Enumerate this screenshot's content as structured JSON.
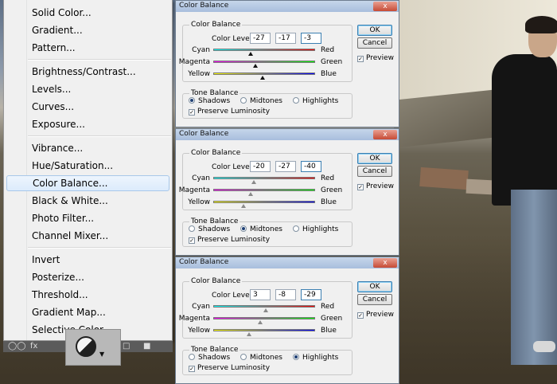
{
  "menu": {
    "items": [
      {
        "label": "Solid Color...",
        "selected": false
      },
      {
        "label": "Gradient...",
        "selected": false
      },
      {
        "label": "Pattern...",
        "selected": false
      },
      {
        "label": "Brightness/Contrast...",
        "selected": false
      },
      {
        "label": "Levels...",
        "selected": false
      },
      {
        "label": "Curves...",
        "selected": false
      },
      {
        "label": "Exposure...",
        "selected": false
      },
      {
        "label": "Vibrance...",
        "selected": false
      },
      {
        "label": "Hue/Saturation...",
        "selected": false
      },
      {
        "label": "Color Balance...",
        "selected": true
      },
      {
        "label": "Black & White...",
        "selected": false
      },
      {
        "label": "Photo Filter...",
        "selected": false
      },
      {
        "label": "Channel Mixer...",
        "selected": false
      },
      {
        "label": "Invert",
        "selected": false
      },
      {
        "label": "Posterize...",
        "selected": false
      },
      {
        "label": "Threshold...",
        "selected": false
      },
      {
        "label": "Gradient Map...",
        "selected": false
      },
      {
        "label": "Selective Color...",
        "selected": false
      }
    ]
  },
  "icons": {
    "adjustment_layer": "half-circle-adjustment-icon",
    "dropdown": "triangle-down-icon",
    "close": "close-icon"
  },
  "dialogs": [
    {
      "title": "Color Balance",
      "close_label": "x",
      "group_label": "Color Balance",
      "levels_label": "Color Levels:",
      "levels": [
        "-27",
        "-17",
        "-3"
      ],
      "sliders": [
        {
          "left": "Cyan",
          "right": "Red",
          "value": -27
        },
        {
          "left": "Magenta",
          "right": "Green",
          "value": -17
        },
        {
          "left": "Yellow",
          "right": "Blue",
          "value": -3
        }
      ],
      "tone_label": "Tone Balance",
      "tones": [
        {
          "label": "Shadows",
          "on": true
        },
        {
          "label": "Midtones",
          "on": false
        },
        {
          "label": "Highlights",
          "on": false
        }
      ],
      "preserve_label": "Preserve Luminosity",
      "ok": "OK",
      "cancel": "Cancel",
      "preview": "Preview"
    },
    {
      "title": "Color Balance",
      "close_label": "x",
      "group_label": "Color Balance",
      "levels_label": "Color Levels:",
      "levels": [
        "-20",
        "-27",
        "-40"
      ],
      "sliders": [
        {
          "left": "Cyan",
          "right": "Red",
          "value": -20
        },
        {
          "left": "Magenta",
          "right": "Green",
          "value": -27
        },
        {
          "left": "Yellow",
          "right": "Blue",
          "value": -40
        }
      ],
      "tone_label": "Tone Balance",
      "tones": [
        {
          "label": "Shadows",
          "on": false
        },
        {
          "label": "Midtones",
          "on": true
        },
        {
          "label": "Highlights",
          "on": false
        }
      ],
      "preserve_label": "Preserve Luminosity",
      "ok": "OK",
      "cancel": "Cancel",
      "preview": "Preview"
    },
    {
      "title": "Color Balance",
      "close_label": "x",
      "group_label": "Color Balance",
      "levels_label": "Color Levels:",
      "levels": [
        "3",
        "-8",
        "-29"
      ],
      "sliders": [
        {
          "left": "Cyan",
          "right": "Red",
          "value": 3
        },
        {
          "left": "Magenta",
          "right": "Green",
          "value": -8
        },
        {
          "left": "Yellow",
          "right": "Blue",
          "value": -29
        }
      ],
      "tone_label": "Tone Balance",
      "tones": [
        {
          "label": "Shadows",
          "on": false
        },
        {
          "label": "Midtones",
          "on": false
        },
        {
          "label": "Highlights",
          "on": true
        }
      ],
      "preserve_label": "Preserve Luminosity",
      "ok": "OK",
      "cancel": "Cancel",
      "preview": "Preview"
    }
  ]
}
